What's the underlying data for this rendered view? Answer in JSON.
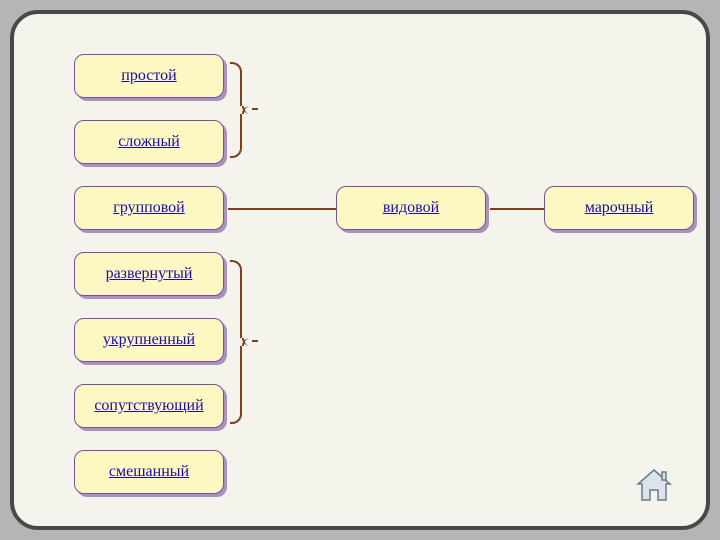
{
  "left_items": [
    "простой",
    "сложный",
    "групповой",
    "развернутый",
    "укрупненный",
    "сопутствующий",
    "смешанный"
  ],
  "middle_item": "видовой",
  "right_item": "марочный",
  "icons": {
    "home": "home-icon"
  }
}
